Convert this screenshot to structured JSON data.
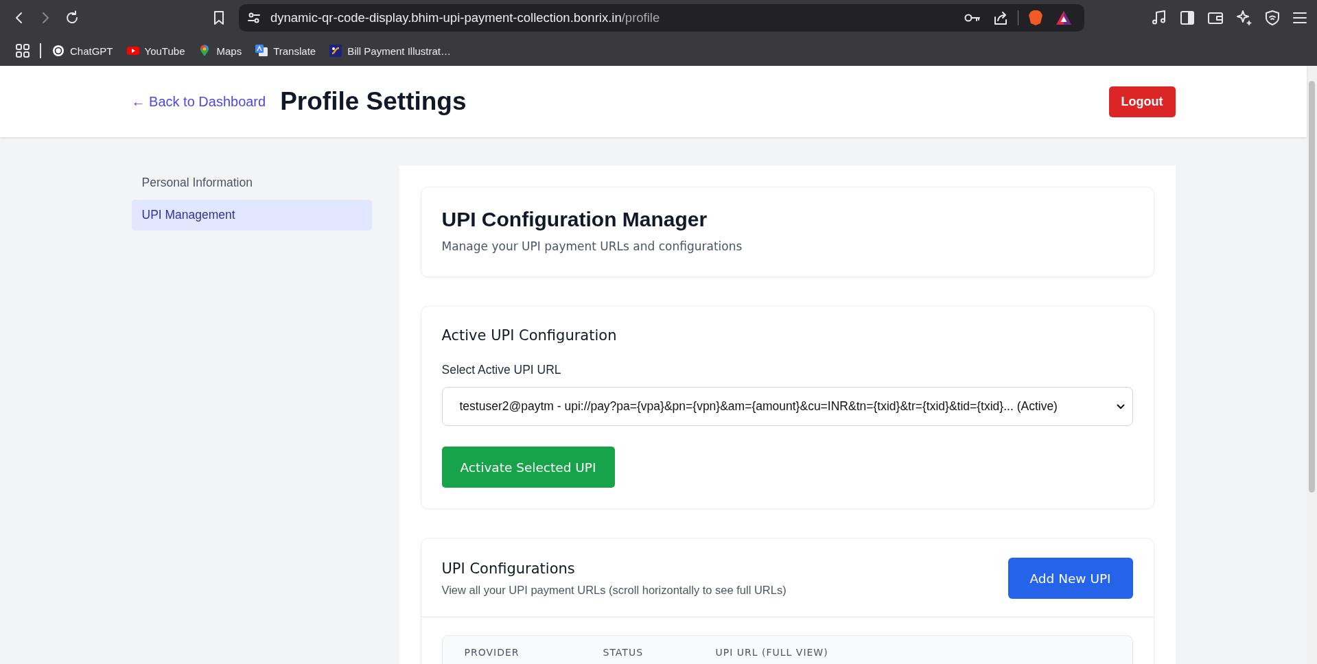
{
  "browser": {
    "url_host": "dynamic-qr-code-display.bhim-upi-payment-collection.bonrix.in",
    "url_path": "/profile",
    "bookmarks": [
      {
        "label": "ChatGPT"
      },
      {
        "label": "YouTube"
      },
      {
        "label": "Maps"
      },
      {
        "label": "Translate"
      },
      {
        "label": "Bill Payment Illustrat…"
      }
    ]
  },
  "header": {
    "back_link": "← Back to Dashboard",
    "title": "Profile Settings",
    "logout": "Logout"
  },
  "sidebar": {
    "items": [
      {
        "label": "Personal Information",
        "selected": false
      },
      {
        "label": "UPI Management",
        "selected": true
      }
    ]
  },
  "intro": {
    "title": "UPI Configuration Manager",
    "subtitle": "Manage your UPI payment URLs and configurations"
  },
  "active_config": {
    "title": "Active UPI Configuration",
    "label": "Select Active UPI URL",
    "value": "testuser2@paytm - upi://pay?pa={vpa}&pn={vpn}&am={amount}&cu=INR&tn={txid}&tr={txid}&tid={txid}... (Active)",
    "button": "Activate Selected UPI"
  },
  "configs": {
    "title": "UPI Configurations",
    "subtitle": "View all your UPI payment URLs (scroll horizontally to see full URLs)",
    "button": "Add New UPI",
    "table": {
      "columns": [
        "PROVIDER",
        "STATUS",
        "UPI URL (FULL VIEW)"
      ]
    }
  }
}
